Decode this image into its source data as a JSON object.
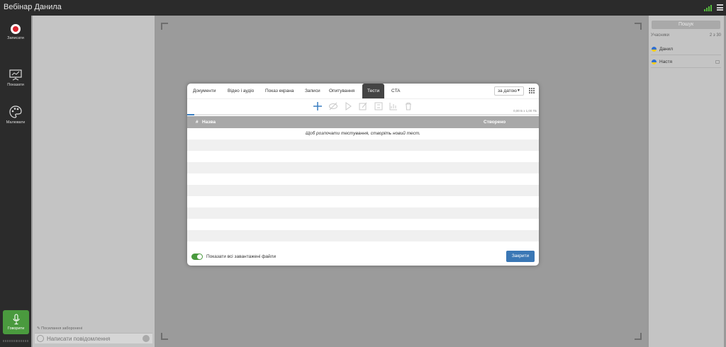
{
  "window": {
    "title": "Вебінар Данила"
  },
  "left_toolbar": {
    "record_label": "Записати",
    "show_label": "Показати",
    "draw_label": "Малювати",
    "speak_label": "Говорити"
  },
  "chat": {
    "hint": "Посилання заборонені",
    "placeholder": "Написати повідомлення"
  },
  "participants": {
    "search_label": "Пошук",
    "heading": "Учасники",
    "count": "2 з 30",
    "list": [
      {
        "name": "Данил"
      },
      {
        "name": "Настя"
      }
    ]
  },
  "modal": {
    "tabs": [
      {
        "label": "Документи",
        "active": false
      },
      {
        "label": "Відео і аудіо",
        "active": false
      },
      {
        "label": "Показ екрана",
        "active": false
      },
      {
        "label": "Записи",
        "active": false
      },
      {
        "label": "Опитування",
        "active": false
      },
      {
        "label": "Тести",
        "active": true
      },
      {
        "label": "CTA",
        "active": false
      }
    ],
    "sort_value": "за датою",
    "storage": "0,00 Б з 1,00 ГБ",
    "table": {
      "col_hash": "#",
      "col_name": "Назва",
      "col_created": "Створено"
    },
    "empty_message": "Щоб розпочати тестування, створіть новий тест.",
    "toggle_label": "Показати всі завантажені файли",
    "close_label": "Закрити"
  },
  "colors": {
    "accent_green": "#4a9a3e",
    "accent_blue": "#3a77b5",
    "record_red": "#d9232d"
  }
}
